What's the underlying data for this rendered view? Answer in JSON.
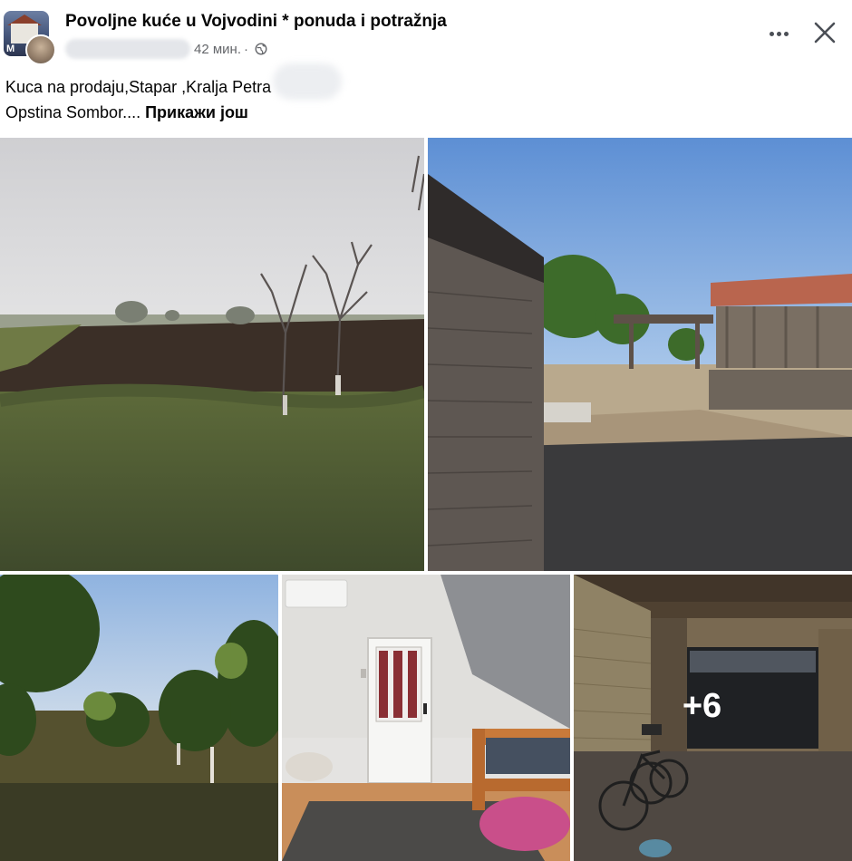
{
  "post": {
    "group_name": "Povoljne kuće u Vojvodini * ponuda i potražnja",
    "time": "42 мин.",
    "separator": "·",
    "text_line_1": "Kuca na prodaju,Stapar ,Kralja Petra",
    "text_line_2": "Opstina Sombor....",
    "see_more": "Прикажи још"
  },
  "icons": {
    "group_avatar": "house-photo",
    "author_avatar": "profile-photo",
    "audience": "globe-icon",
    "more": "more-options-icon",
    "close": "close-icon"
  },
  "avatar_text": "M",
  "gallery": {
    "extra_count": "+6",
    "photos": [
      {
        "subject": "field-with-bare-trees"
      },
      {
        "subject": "brick-wall-and-barn-yard"
      },
      {
        "subject": "garden-with-trees"
      },
      {
        "subject": "room-with-door-and-bed"
      },
      {
        "subject": "garage-with-bicycles"
      }
    ]
  },
  "colors": {
    "text_primary": "#050505",
    "text_secondary": "#65676b",
    "background": "#ffffff"
  }
}
